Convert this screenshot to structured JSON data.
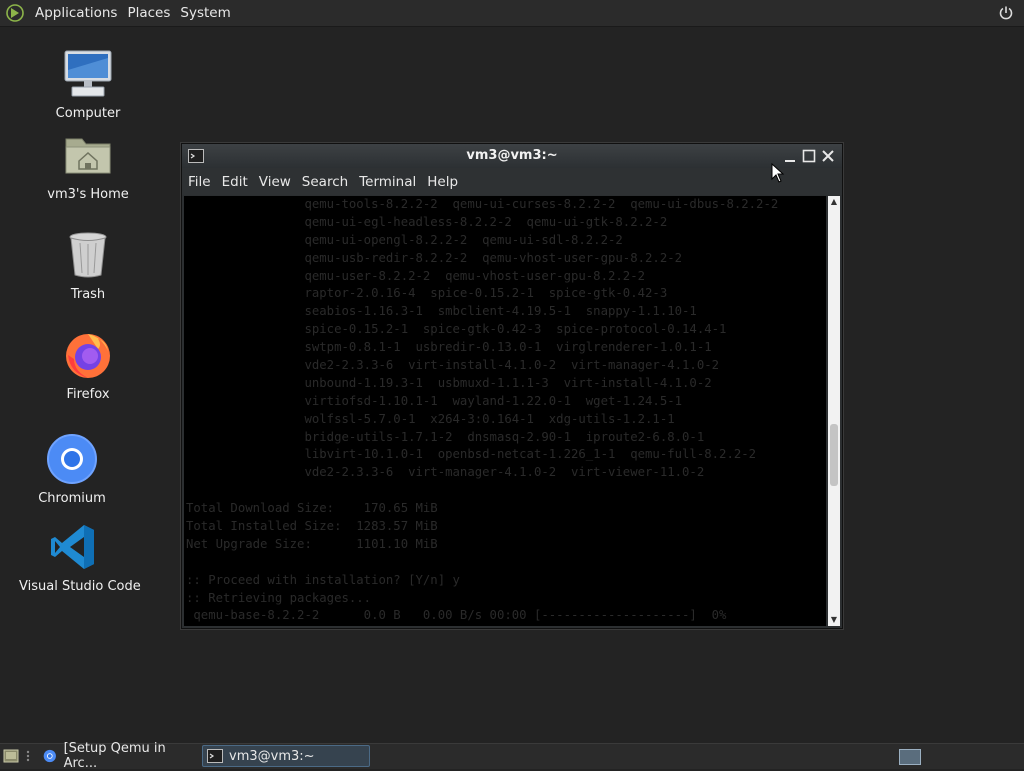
{
  "top_panel": {
    "menus": [
      "Applications",
      "Places",
      "System"
    ]
  },
  "desktop": {
    "icons": [
      {
        "label": "Computer",
        "icon": "computer-icon"
      },
      {
        "label": "vm3's Home",
        "icon": "home-folder-icon"
      },
      {
        "label": "Trash",
        "icon": "trash-icon"
      },
      {
        "label": "Firefox",
        "icon": "firefox-icon"
      },
      {
        "label": "Chromium",
        "icon": "chromium-icon"
      },
      {
        "label": "Visual Studio Code",
        "icon": "vscode-icon"
      }
    ]
  },
  "terminal": {
    "title": "vm3@vm3:~",
    "menu": [
      "File",
      "Edit",
      "View",
      "Search",
      "Terminal",
      "Help"
    ],
    "lines": [
      "                qemu-tools-8.2.2-2  qemu-ui-curses-8.2.2-2  qemu-ui-dbus-8.2.2-2",
      "                qemu-ui-egl-headless-8.2.2-2  qemu-ui-gtk-8.2.2-2",
      "                qemu-ui-opengl-8.2.2-2  qemu-ui-sdl-8.2.2-2",
      "                qemu-usb-redir-8.2.2-2  qemu-vhost-user-gpu-8.2.2-2",
      "                qemu-user-8.2.2-2  qemu-vhost-user-gpu-8.2.2-2",
      "                raptor-2.0.16-4  spice-0.15.2-1  spice-gtk-0.42-3",
      "                seabios-1.16.3-1  smbclient-4.19.5-1  snappy-1.1.10-1",
      "                spice-0.15.2-1  spice-gtk-0.42-3  spice-protocol-0.14.4-1",
      "                swtpm-0.8.1-1  usbredir-0.13.0-1  virglrenderer-1.0.1-1",
      "                vde2-2.3.3-6  virt-install-4.1.0-2  virt-manager-4.1.0-2",
      "                unbound-1.19.3-1  usbmuxd-1.1.1-3  virt-install-4.1.0-2",
      "                virtiofsd-1.10.1-1  wayland-1.22.0-1  wget-1.24.5-1",
      "                wolfssl-5.7.0-1  x264-3:0.164-1  xdg-utils-1.2.1-1",
      "                bridge-utils-1.7.1-2  dnsmasq-2.90-1  iproute2-6.8.0-1",
      "                libvirt-10.1.0-1  openbsd-netcat-1.226_1-1  qemu-full-8.2.2-2",
      "                vde2-2.3.3-6  virt-manager-4.1.0-2  virt-viewer-11.0-2",
      "",
      "Total Download Size:    170.65 MiB",
      "Total Installed Size:  1283.57 MiB",
      "Net Upgrade Size:      1101.10 MiB",
      "",
      ":: Proceed with installation? [Y/n] y",
      ":: Retrieving packages...",
      " qemu-base-8.2.2-2      0.0 B   0.00 B/s 00:00 [--------------------]  0%"
    ]
  },
  "taskbar": {
    "tasks": [
      {
        "label": "[Setup Qemu in Arc...",
        "active": false
      },
      {
        "label": "vm3@vm3:~",
        "active": true
      }
    ]
  }
}
